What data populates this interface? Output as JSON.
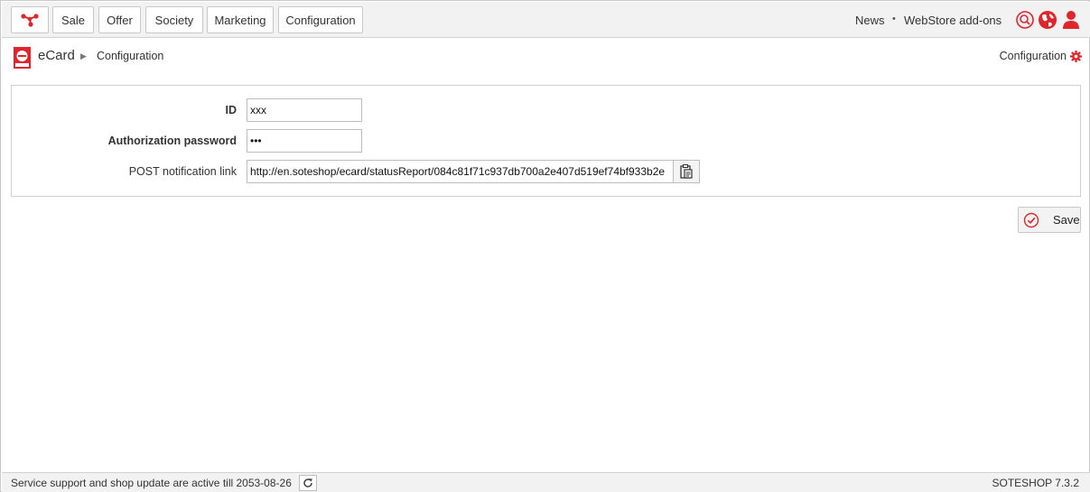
{
  "nav": {
    "items": [
      {
        "label": "Sale"
      },
      {
        "label": "Offer"
      },
      {
        "label": "Society"
      },
      {
        "label": "Marketing"
      },
      {
        "label": "Configuration"
      }
    ],
    "right_links": [
      {
        "label": "News"
      },
      {
        "label": "WebStore add-ons"
      }
    ],
    "separator": "•",
    "icons": [
      "search-icon",
      "globe-icon",
      "user-icon"
    ]
  },
  "breadcrumb": {
    "module": "eCard",
    "separator": "▶",
    "current": "Configuration",
    "right_link": "Configuration"
  },
  "form": {
    "fields": [
      {
        "label": "ID",
        "value": "xxx"
      },
      {
        "label": "Authorization password",
        "value": "•••"
      },
      {
        "label": "POST notification link",
        "value": "http://en.soteshop/ecard/statusReport/084c81f71c937db700a2e407d519ef74bf933b2e"
      }
    ],
    "save_label": "Save"
  },
  "footer": {
    "support_text": "Service support and shop update are active till 2053-08-26",
    "version": "SOTESHOP 7.3.2"
  },
  "colors": {
    "accent": "#e0262c",
    "bar_bg": "#f2f2f2",
    "border": "#c8c8c8"
  }
}
